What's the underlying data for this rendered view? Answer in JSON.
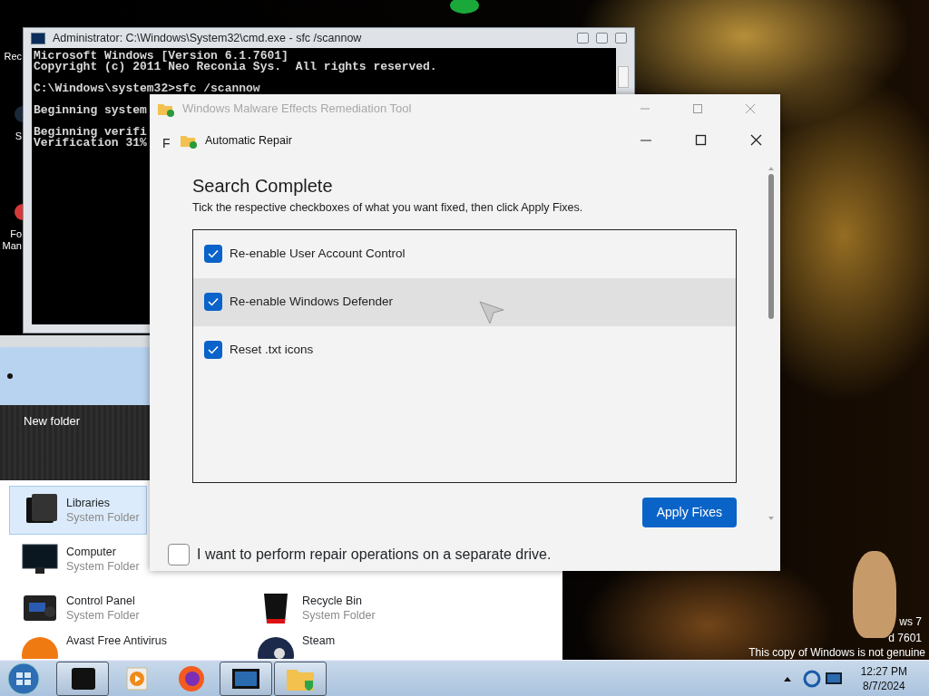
{
  "desktop_icons": [
    {
      "kind": "recycle",
      "lines": [
        "Rec"
      ]
    },
    {
      "kind": "steam",
      "lines": [
        "S"
      ]
    },
    {
      "kind": "red-circle",
      "lines": [
        "Fo",
        "Man"
      ]
    }
  ],
  "console_window": {
    "title": "Administrator: C:\\Windows\\System32\\cmd.exe - sfc  /scannow",
    "lines": [
      {
        "text": "Microsoft Windows [Version 6.1.7601]"
      },
      {
        "text": "Copyright (c) 2011 Neo Reconia Sys.  All rights reserved."
      },
      {
        "text": "C:\\Windows\\system32>sfc /scannow",
        "blank_before": true
      },
      {
        "text": "Beginning system",
        "blank_before": true
      },
      {
        "text": "Beginning verifi",
        "blank_before": true
      },
      {
        "text": "Verification 31%"
      }
    ]
  },
  "explorer": {
    "folder_label": "New folder",
    "left_column": [
      {
        "kind": "libraries",
        "name": "Libraries",
        "subtitle": "System Folder",
        "selected": true
      },
      {
        "kind": "computer",
        "name": "Computer",
        "subtitle": "System Folder",
        "selected": false
      },
      {
        "kind": "control-panel",
        "name": "Control Panel",
        "subtitle": "System Folder",
        "selected": false
      },
      {
        "kind": "avast",
        "name": "Avast Free Antivirus",
        "selected": false
      }
    ],
    "right_column": [
      {
        "kind": "recycle-bin",
        "name": "Recycle Bin",
        "subtitle": "System Folder",
        "selected": false
      },
      {
        "kind": "steam",
        "name": "Steam",
        "selected": false
      }
    ]
  },
  "remediation_window": {
    "title": "Windows Malware Effects Remediation Tool",
    "active": false,
    "side_letter": "F",
    "separate_drive": {
      "label": "I want to perform repair operations on a separate drive.",
      "checked": false
    }
  },
  "repair_dialog": {
    "title": "Automatic Repair",
    "heading": "Search Complete",
    "instructions": "Tick the respective checkboxes of what you want fixed, then click Apply Fixes.",
    "fixes": [
      {
        "label": "Re-enable User Account Control",
        "checked": true,
        "highlighted": false
      },
      {
        "label": "Re-enable Windows Defender",
        "checked": true,
        "highlighted": true
      },
      {
        "label": "Reset .txt icons",
        "checked": true,
        "highlighted": false
      }
    ],
    "apply_button": "Apply Fixes"
  },
  "watermark_lines": [
    "ws 7",
    "d 7601",
    "This copy of Windows is not genuine"
  ],
  "taskbar": {
    "apps": [
      {
        "kind": "black-box",
        "open": true
      },
      {
        "kind": "media-player",
        "open": false
      },
      {
        "kind": "firefox",
        "open": false
      },
      {
        "kind": "monitor",
        "open": true
      },
      {
        "kind": "folder-shield",
        "open": true
      }
    ],
    "time": "12:27 PM",
    "date": "8/7/2024"
  }
}
